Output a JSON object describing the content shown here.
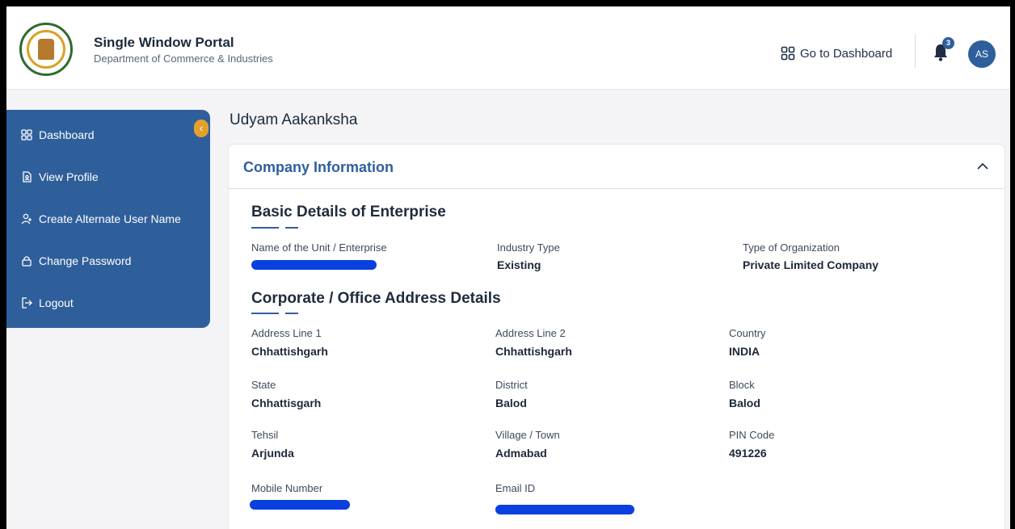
{
  "header": {
    "title": "Single Window Portal",
    "subtitle": "Department of Commerce & Industries",
    "dashboard_link": "Go to Dashboard",
    "notification_count": "3",
    "avatar_initials": "AS"
  },
  "sidebar": {
    "items": [
      {
        "label": "Dashboard",
        "icon": "grid-icon"
      },
      {
        "label": "View Profile",
        "icon": "profile-doc-icon"
      },
      {
        "label": "Create Alternate User Name",
        "icon": "user-add-icon"
      },
      {
        "label": "Change Password",
        "icon": "lock-icon"
      },
      {
        "label": "Logout",
        "icon": "logout-icon"
      }
    ]
  },
  "page": {
    "title": "Udyam Aakanksha"
  },
  "company_info": {
    "title": "Company Information",
    "basic": {
      "title": "Basic Details of Enterprise",
      "unit_name_label": "Name of the Unit / Enterprise",
      "industry_type_label": "Industry Type",
      "industry_type": "Existing",
      "org_type_label": "Type of Organization",
      "org_type": "Private Limited Company"
    },
    "address": {
      "title": "Corporate / Office Address Details",
      "address1_label": "Address Line 1",
      "address1": "Chhattishgarh",
      "address2_label": "Address Line 2",
      "address2": "Chhattishgarh",
      "country_label": "Country",
      "country": "INDIA",
      "state_label": "State",
      "state": "Chhattisgarh",
      "district_label": "District",
      "district": "Balod",
      "block_label": "Block",
      "block": "Balod",
      "tehsil_label": "Tehsil",
      "tehsil": "Arjunda",
      "village_label": "Village / Town",
      "village": "Admabad",
      "pin_label": "PIN Code",
      "pin": "491226",
      "mobile_label": "Mobile Number",
      "email_label": "Email ID"
    }
  },
  "colors": {
    "primary": "#2f5f9b",
    "accent": "#e2a12c",
    "redaction": "#0a3fe0"
  }
}
